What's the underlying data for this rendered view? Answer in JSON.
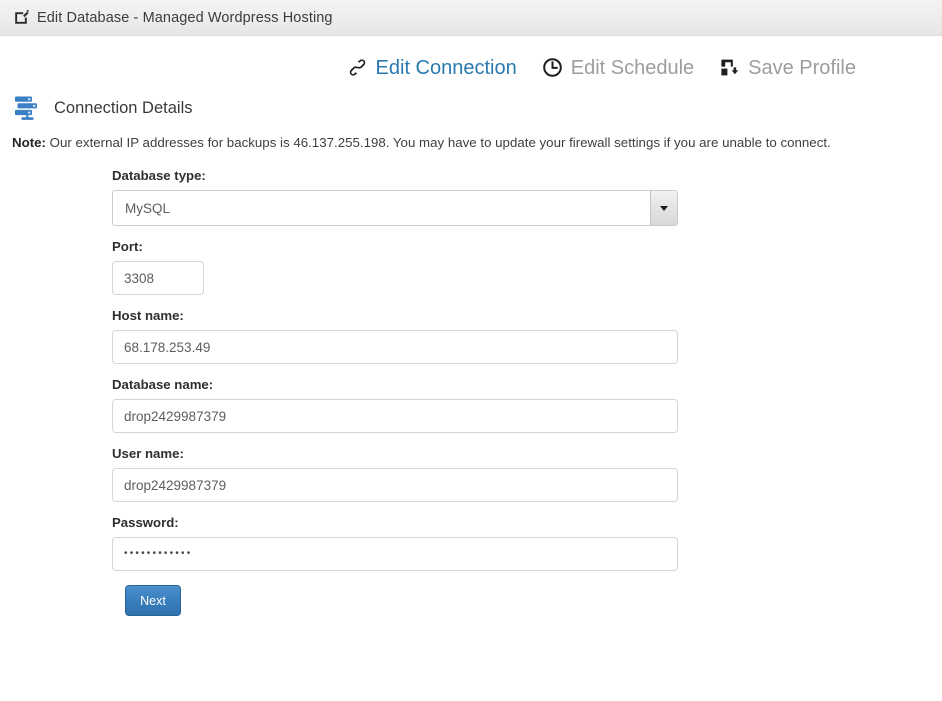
{
  "window": {
    "icon": "edit-square-icon",
    "title": "Edit Database - Managed Wordpress Hosting"
  },
  "toolbar": {
    "items": [
      {
        "icon": "link-icon",
        "label": "Edit Connection",
        "state": "active"
      },
      {
        "icon": "clock-icon",
        "label": "Edit Schedule",
        "state": "disabled"
      },
      {
        "icon": "save-floppy-icon",
        "label": "Save Profile",
        "state": "disabled"
      }
    ],
    "active_color": "#2a7ab0",
    "disabled_color": "#9d9d9d"
  },
  "section": {
    "icon": "server-stack-icon",
    "title": "Connection Details"
  },
  "note": {
    "label": "Note:",
    "text": " Our external IP addresses for backups is 46.137.255.198. You may have to update your firewall settings if you are unable to connect.",
    "ip_address": "46.137.255.198"
  },
  "form": {
    "database_type": {
      "label": "Database type:",
      "value": "MySQL",
      "options": [
        "MySQL"
      ]
    },
    "port": {
      "label": "Port:",
      "value": "3308"
    },
    "host_name": {
      "label": "Host name:",
      "value": "68.178.253.49"
    },
    "database_name": {
      "label": "Database name:",
      "value": "drop2429987379"
    },
    "user_name": {
      "label": "User name:",
      "value": "drop2429987379"
    },
    "password": {
      "label": "Password:",
      "value": "••••••••••••",
      "masked_length": 12
    },
    "submit": {
      "label": "Next",
      "color": "#3a7fbd"
    }
  }
}
